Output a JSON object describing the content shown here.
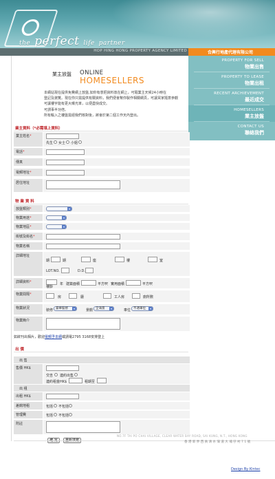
{
  "header": {
    "logo_text_the": "the",
    "logo_text_perfect": "perfect",
    "logo_text_life": "life",
    "logo_text_partner": "partner",
    "agency_en": "HOP HING HONG PROPERTY AGENCY LIMITED",
    "agency_zh": "合興行地產代理有限公司"
  },
  "sidebar": {
    "items": [
      {
        "en": "PROPERTY FOR SELL",
        "zh": "物業出售"
      },
      {
        "en": "PROPERTY TO LEASE",
        "zh": "物業出租"
      },
      {
        "en": "RECENT ARCHIEVEMENT",
        "zh": "最近成交"
      },
      {
        "en": "HOMESELLERS",
        "zh": "業主放盤"
      },
      {
        "en": "CONTACT US",
        "zh": "聯絡我們"
      }
    ]
  },
  "intro": {
    "zh": "業主放盤",
    "online": "ONLINE",
    "homesellers": "HOMESELLERS",
    "lines": [
      "本網站現在提供免費網上放盤,如你有意把資料放在網上，可隨業主天候24小時在",
      "登記及瀏覽。現在你只需提供有關資料，我們便會幫你製作相關網頁，可讓買家隨意參觀",
      "可讓樓宇能有更大曝光率，以便盡快成交。",
      "可謂事半功倍。",
      "所有輸入之樓盤需經我們核對後，將會於第二個工作天內登出。"
    ]
  },
  "owner": {
    "section_title": "業主資料（*必需填上資料）",
    "name_label": "業主姓名",
    "title_mr": "先生",
    "title_ms": "女士",
    "title_miss": "小姐",
    "phone_label": "電話",
    "fax_label": "傳真",
    "email_label": "電郵地址",
    "address_label": "居住地址"
  },
  "property": {
    "section_title": "物 業 資 料",
    "type_label": "放盤類別",
    "use_label": "物業用途",
    "district_label": "物業地區",
    "street_label": "街號及街名",
    "estate_label": "物業名稱",
    "detail_label": "詳細地址",
    "addr_units": [
      "期",
      "座",
      "樓",
      "室"
    ],
    "lot_no": "LOT.NO.",
    "dd": "D.D.",
    "info_label": "詳細資料",
    "age_unit": "樓齡",
    "year": "年",
    "gross_area": "建築面積",
    "sqft": "平方呎",
    "net_area": "實用面積",
    "layout_label": "物業間隔",
    "rooms": "房",
    "halls": "廳",
    "workers_room": "工人房",
    "toilets": "廁所數",
    "condition_label": "物業狀況",
    "decoration": "裝修",
    "decoration_value": "豪華裝修",
    "view": "景觀",
    "view_value": "全海景",
    "parking": "車位",
    "parking_value": "不適車位",
    "intro_label": "物業簡介",
    "photo_note_a": "如欲刊出相片，歡迎",
    "photo_note_link": "電郵予本網",
    "photo_note_b": "或請電2795 3168安排登上"
  },
  "price": {
    "section_title": "出 價",
    "sale_header": "出 售",
    "price_label": "售價 HK$",
    "deal_label": "交吉",
    "leased_label": "連約出售",
    "lease_rent": "連約租金HK$",
    "lease_expiry": "租期至",
    "rent_header": "出 租",
    "rent_label": "出租 HK$",
    "rates_label": "差餉地租",
    "mgmt_label": "管理費",
    "included": "包括",
    "not_included": "不包括",
    "remarks_label": "附註",
    "submit": "確 定",
    "reset": "重新填寫"
  },
  "footer": {
    "address_en": "NO.7F TAI PO CHAI VILLAGE, CLEAR WATER BAY ROAD, SAI KUNG, N.T., HONG KONG",
    "address_zh": "香 港 新 界 西 貢 清 水 灣 道 大 埔 仔 村 7 1 號",
    "credit": "Design By Kintec"
  }
}
